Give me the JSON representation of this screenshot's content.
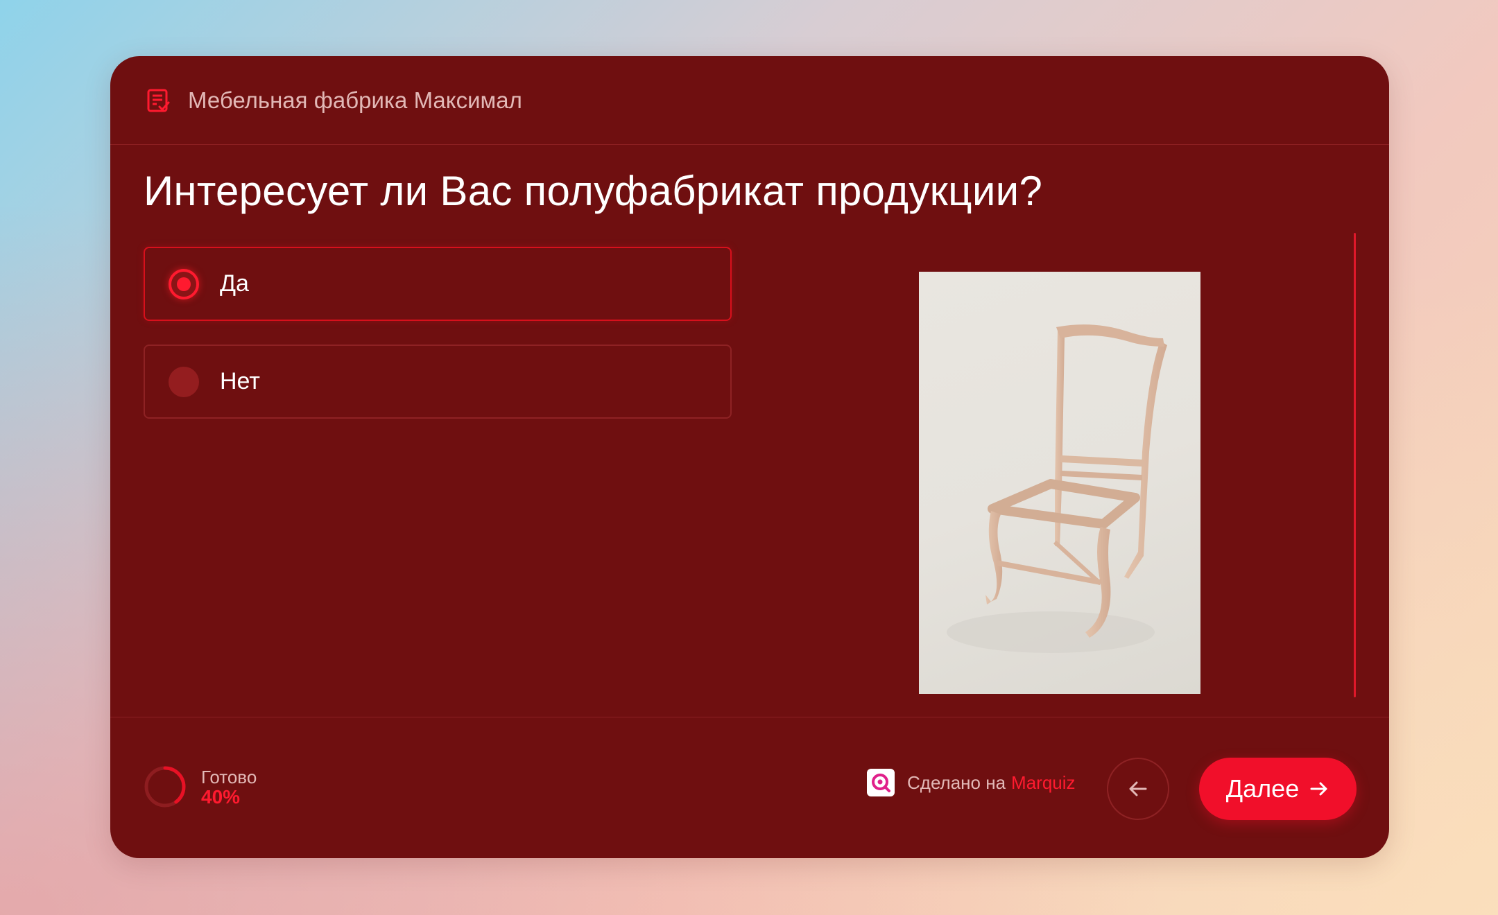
{
  "header": {
    "title": "Мебельная фабрика Максимал",
    "icon": "form-check-icon"
  },
  "question": {
    "text": "Интересует ли Вас полуфабрикат продукции?"
  },
  "options": [
    {
      "label": "Да",
      "selected": true
    },
    {
      "label": "Нет",
      "selected": false
    }
  ],
  "image": {
    "subject": "unfinished-wooden-chair-frame"
  },
  "footer": {
    "progress_label": "Готово",
    "progress_value": "40%",
    "progress_fraction": 0.4,
    "made_on_text": "Сделано на",
    "made_on_brand": "Marquiz",
    "next_label": "Далее",
    "back_icon": "arrow-left-icon",
    "next_icon": "arrow-right-icon"
  },
  "colors": {
    "card_background": "#6f0f10",
    "accent": "#f10f2a",
    "muted_text": "#e2b8b6"
  }
}
